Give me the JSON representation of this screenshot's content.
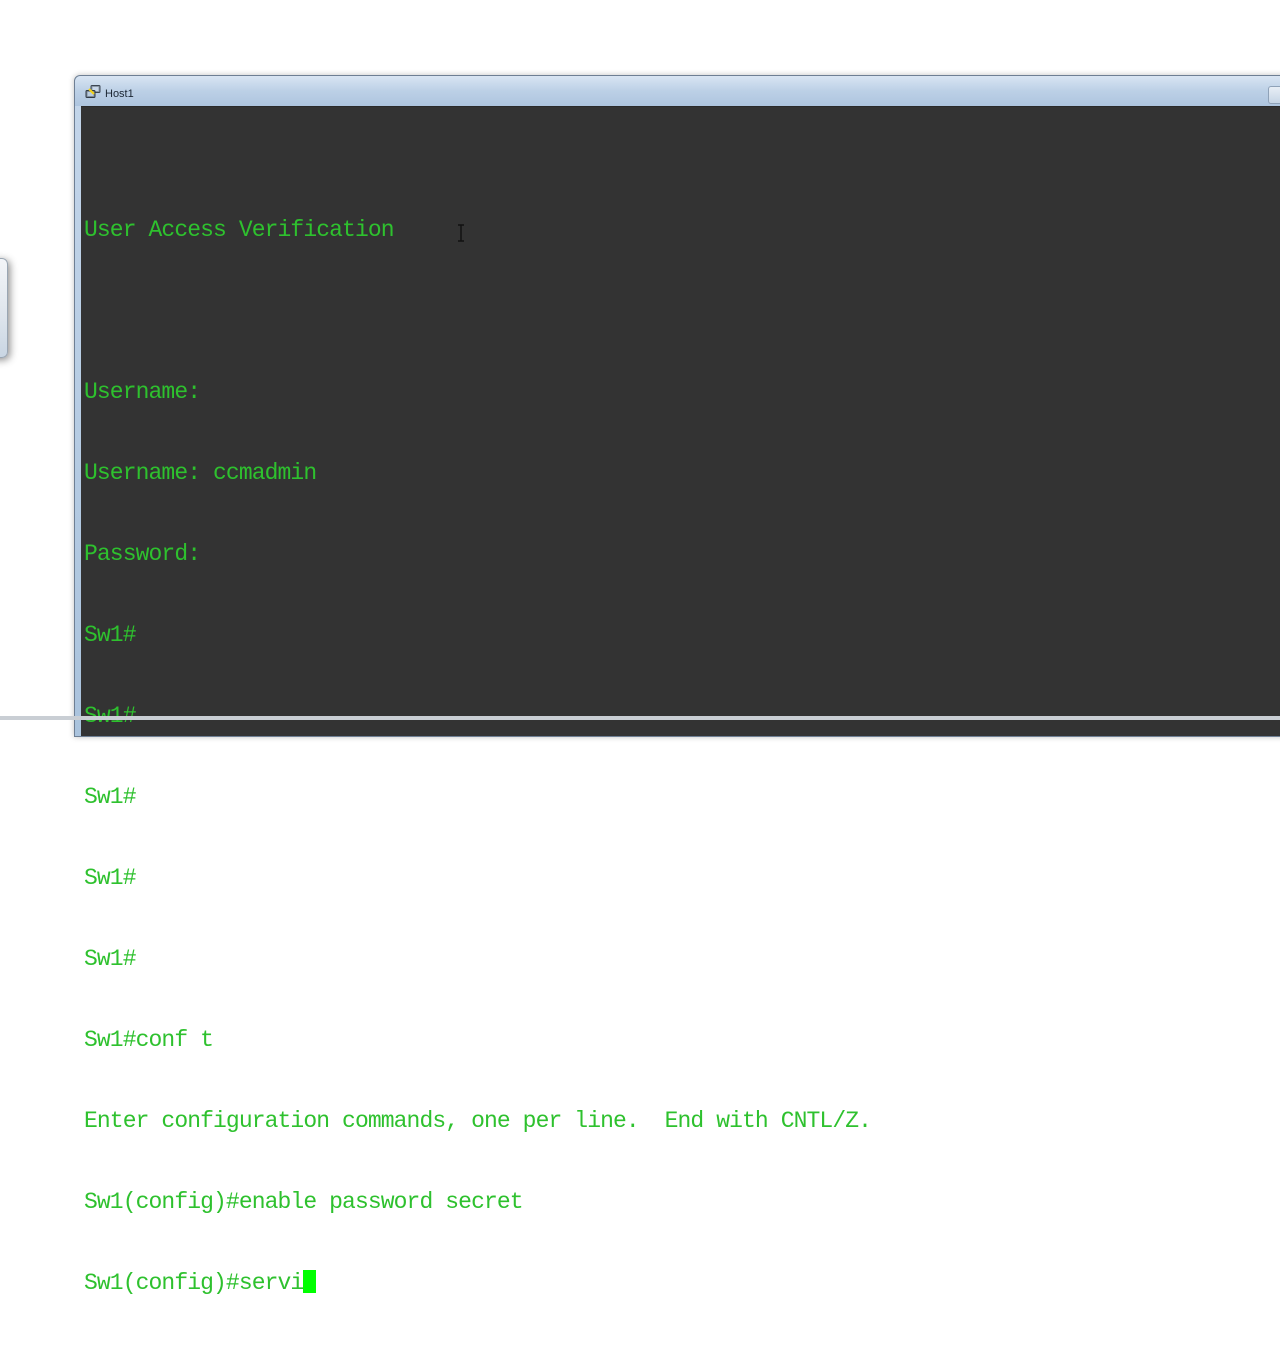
{
  "window": {
    "title": "Host1",
    "app_icon": "network-connection-icon"
  },
  "terminal": {
    "lines": [
      "",
      "",
      "User Access Verification",
      "",
      "Username:",
      "Username: ccmadmin",
      "Password:",
      "Sw1#",
      "Sw1#",
      "Sw1#",
      "Sw1#",
      "Sw1#",
      "Sw1#conf t",
      "Enter configuration commands, one per line.  End with CNTL/Z.",
      "Sw1(config)#enable password secret",
      "Sw1(config)#servi"
    ],
    "current_input": "Sw1(config)#servi",
    "text_color": "#2ec12e",
    "cursor_color": "#00ff00",
    "background_color": "#333333"
  }
}
